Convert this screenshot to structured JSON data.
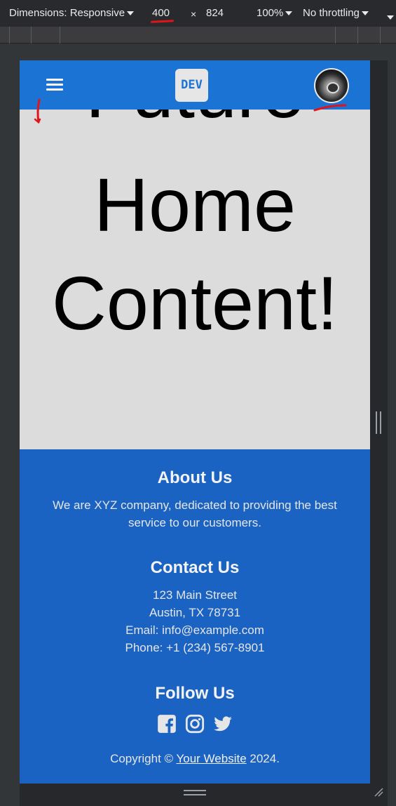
{
  "devtools": {
    "dimensions_label": "Dimensions: Responsive",
    "width": "400",
    "times": "×",
    "height": "824",
    "zoom": "100%",
    "throttling": "No throttling"
  },
  "navbar": {
    "logo_text": "DEV",
    "menu_icon": "hamburger-menu-icon",
    "avatar_icon": "user-avatar"
  },
  "hero": {
    "line1": "Future",
    "line2": "Home",
    "line3": "Content!"
  },
  "footer": {
    "about_title": "About Us",
    "about_text": "We are XYZ company, dedicated to providing the best service to our customers.",
    "contact_title": "Contact Us",
    "address_line1": "123 Main Street",
    "address_line2": "Austin, TX 78731",
    "email": "Email: info@example.com",
    "phone": "Phone: +1 (234) 567-8901",
    "follow_title": "Follow Us",
    "social_icons": [
      "facebook-icon",
      "instagram-icon",
      "twitter-icon"
    ],
    "copyright_prefix": "Copyright © ",
    "copyright_link": "Your Website",
    "copyright_suffix": " 2024."
  },
  "colors": {
    "navbar": "#1b74d3",
    "footer": "#1b63c2",
    "hero_bg": "#dcdcdc",
    "annotation": "#e0141b"
  }
}
